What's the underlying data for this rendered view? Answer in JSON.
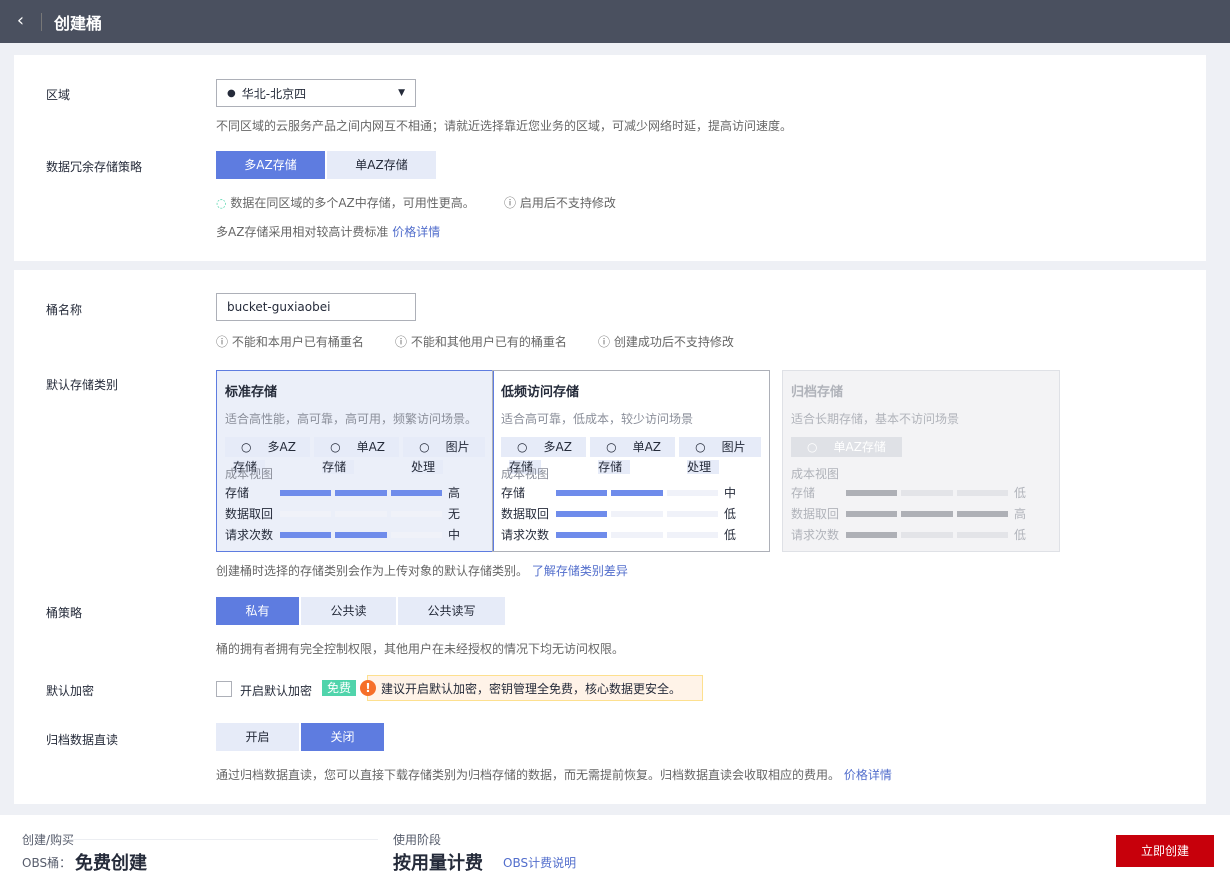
{
  "header": {
    "title": "创建桶",
    "back_icon": "chevron-left-icon"
  },
  "region": {
    "label": "区域",
    "value": "华北-北京四",
    "hint": "不同区域的云服务产品之间内网互不相通；请就近选择靠近您业务的区域，可减少网络时延，提高访问速度。"
  },
  "redundancy": {
    "label": "数据冗余存储策略",
    "options": [
      "多AZ存储",
      "单AZ存储"
    ],
    "selected": "多AZ存储",
    "check_note": "数据在同区域的多个AZ中存储，可用性更高。",
    "info_note": "启用后不支持修改",
    "price_note": "多AZ存储采用相对较高计费标准",
    "price_link": "价格详情"
  },
  "bucket_name": {
    "label": "桶名称",
    "value": "bucket-guxiaobei",
    "rules": [
      "不能和本用户已有桶重名",
      "不能和其他用户已有的桶重名",
      "创建成功后不支持修改"
    ]
  },
  "storage_class": {
    "label": "默认存储类别",
    "cost_title": "成本视图",
    "rows": [
      "存储",
      "数据取回",
      "请求次数"
    ],
    "cards": [
      {
        "title": "标准存储",
        "desc": "适合高性能，高可靠，高可用，频繁访问场景。",
        "tags": [
          "多AZ存储",
          "单AZ存储",
          "图片处理"
        ],
        "levels": [
          3,
          0,
          2
        ],
        "values": [
          "高",
          "无",
          "中"
        ],
        "state": "selected"
      },
      {
        "title": "低频访问存储",
        "desc": "适合高可靠，低成本，较少访问场景",
        "tags": [
          "多AZ存储",
          "单AZ存储",
          "图片处理"
        ],
        "levels": [
          2,
          1,
          1
        ],
        "values": [
          "中",
          "低",
          "低"
        ],
        "state": "normal"
      },
      {
        "title": "归档存储",
        "desc": "适合长期存储，基本不访问场景",
        "tags": [
          "单AZ存储"
        ],
        "levels": [
          1,
          3,
          1
        ],
        "values": [
          "低",
          "高",
          "低"
        ],
        "state": "disabled"
      }
    ],
    "note": "创建桶时选择的存储类别会作为上传对象的默认存储类别。",
    "note_link": "了解存储类别差异"
  },
  "policy": {
    "label": "桶策略",
    "options": [
      "私有",
      "公共读",
      "公共读写"
    ],
    "selected": "私有",
    "hint": "桶的拥有者拥有完全控制权限，其他用户在未经授权的情况下均无访问权限。"
  },
  "encryption": {
    "label": "默认加密",
    "checkbox_label": "开启默认加密",
    "checked": false,
    "badge": "免费",
    "warning": "建议开启默认加密，密钥管理全免费，核心数据更安全。"
  },
  "archive_read": {
    "label": "归档数据直读",
    "options": [
      "开启",
      "关闭"
    ],
    "selected": "关闭",
    "hint": "通过归档数据直读，您可以直接下载存储类别为归档存储的数据，而无需提前恢复。归档数据直读会收取相应的费用。",
    "link": "价格详情"
  },
  "footer": {
    "create_label": "创建/购买",
    "obs_label": "OBS桶：",
    "obs_value": "免费创建",
    "usage_label": "使用阶段",
    "usage_value": "按用量计费",
    "billing_link": "OBS计费说明",
    "submit": "立即创建"
  },
  "colors": {
    "accent": "#5e7ce0",
    "danger": "#c7000b",
    "header": "#4a505f"
  }
}
